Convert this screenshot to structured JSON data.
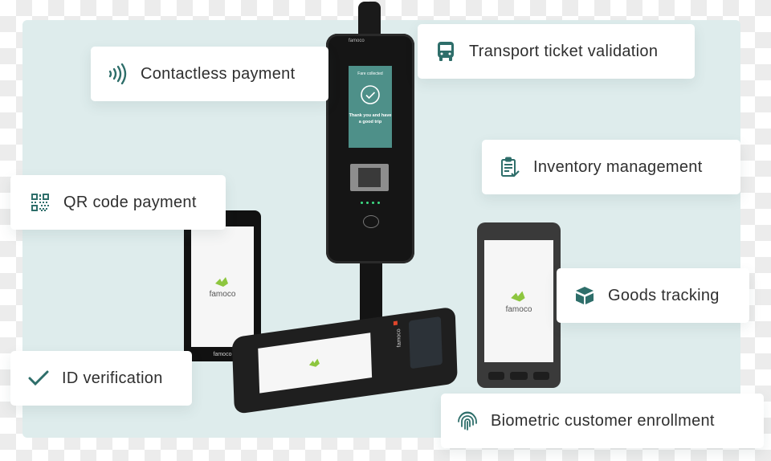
{
  "colors": {
    "accent": "#2e6e6a",
    "panel_bg": "#deecec",
    "card_bg": "#ffffff",
    "text": "#2f2f2f",
    "validator_screen": "#4e9089",
    "brand_green": "#8dc63f"
  },
  "features": [
    {
      "id": "contactless",
      "label": "Contactless payment",
      "icon": "contactless-icon"
    },
    {
      "id": "transport",
      "label": "Transport ticket validation",
      "icon": "bus-icon"
    },
    {
      "id": "inventory",
      "label": "Inventory management",
      "icon": "clipboard-check-icon"
    },
    {
      "id": "qr",
      "label": "QR code payment",
      "icon": "qr-code-icon"
    },
    {
      "id": "goods",
      "label": "Goods tracking",
      "icon": "box-icon"
    },
    {
      "id": "id",
      "label": "ID verification",
      "icon": "checkmark-icon"
    },
    {
      "id": "biometric",
      "label": "Biometric customer enrollment",
      "icon": "fingerprint-icon"
    }
  ],
  "devices": {
    "validator": {
      "brand": "famoco",
      "screen_title": "Fare collected",
      "screen_message": "Thank you and have a good trip"
    },
    "brand_name": "famoco"
  }
}
